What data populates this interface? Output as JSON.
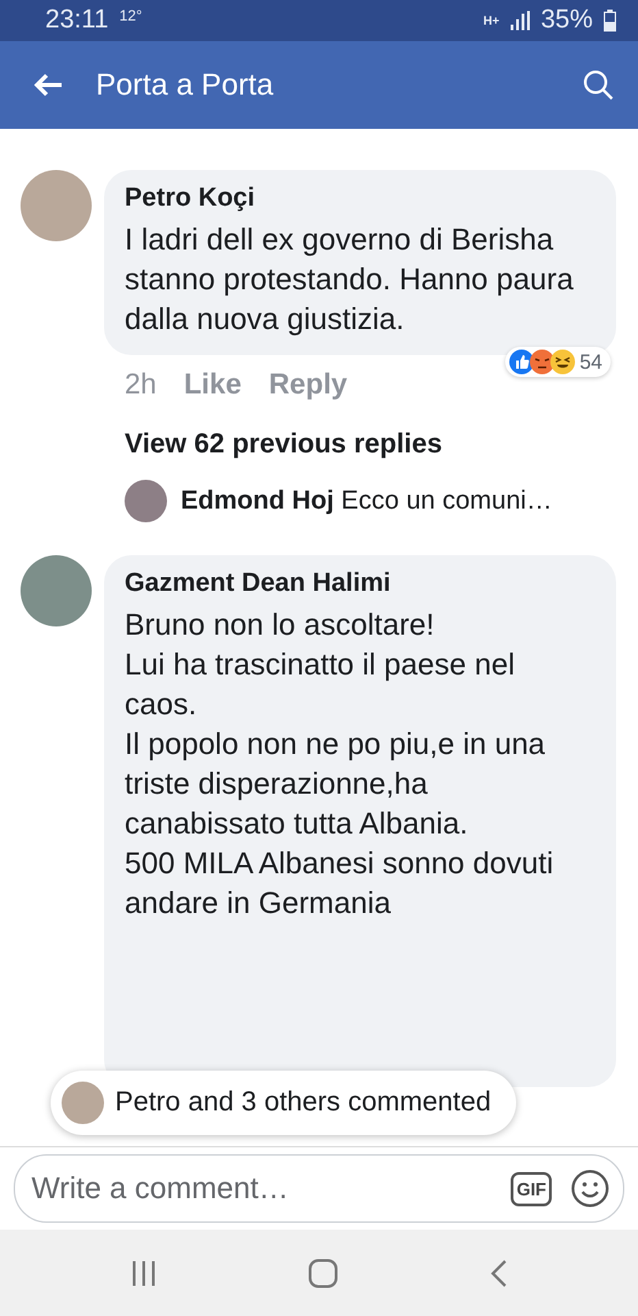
{
  "status_bar": {
    "time": "23:11",
    "temperature": "12°",
    "network": "H+",
    "battery": "35%"
  },
  "app_bar": {
    "title": "Porta a Porta"
  },
  "comments": [
    {
      "author": "Petro Koçi",
      "text": "I ladri dell ex governo di Berisha stanno protestando. Hanno paura dalla nuova giustizia.",
      "time": "2h",
      "like": "Like",
      "reply": "Reply",
      "reaction_count": "54",
      "view_replies": "View 62 previous replies",
      "reply_preview": {
        "author": "Edmond Hoj",
        "text": "Ecco un comuni…"
      }
    },
    {
      "author": "Gazment Dean Halimi",
      "text": "Bruno non lo ascoltare!\nLui ha trascinatto il paese nel caos.\nIl popolo non ne po piu,e in una triste disperazionne,ha canabissato tutta Albania.\n500 MILA Albanesi sonno dovuti andare  in Germania"
    }
  ],
  "new_comments_pill": {
    "text": "Petro and 3 others commented"
  },
  "composer": {
    "placeholder": "Write a comment…",
    "gif": "GIF"
  }
}
